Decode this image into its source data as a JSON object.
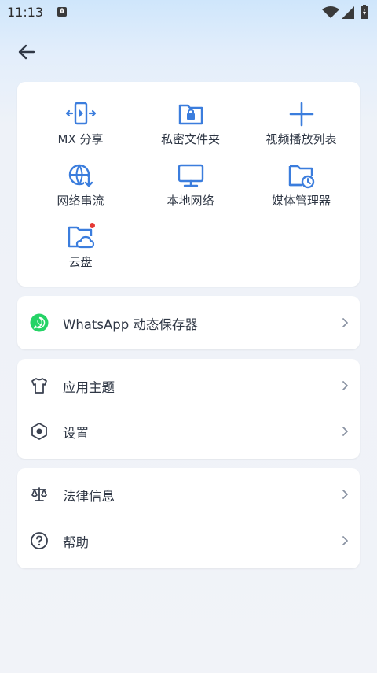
{
  "status_bar": {
    "time": "11:13",
    "notification_letter": "A"
  },
  "colors": {
    "accent": "#3b7ddd",
    "text": "#2f3745",
    "icon_dark": "#3a4150",
    "whatsapp_green": "#25d366",
    "badge_red": "#e53935"
  },
  "header": {
    "back_icon": "arrow-left-icon"
  },
  "grid": {
    "items": [
      {
        "label": "MX 分享",
        "icon": "mx-share-icon"
      },
      {
        "label": "私密文件夹",
        "icon": "private-folder-icon"
      },
      {
        "label": "视频播放列表",
        "icon": "plus-icon"
      },
      {
        "label": "网络串流",
        "icon": "network-stream-icon"
      },
      {
        "label": "本地网络",
        "icon": "local-network-icon"
      },
      {
        "label": "媒体管理器",
        "icon": "media-manager-icon"
      },
      {
        "label": "云盘",
        "icon": "cloud-drive-icon",
        "has_badge": true
      }
    ]
  },
  "whatsapp": {
    "label": "WhatsApp 动态保存器"
  },
  "settings_group": {
    "theme_label": "应用主题",
    "settings_label": "设置"
  },
  "info_group": {
    "legal_label": "法律信息",
    "help_label": "帮助"
  }
}
